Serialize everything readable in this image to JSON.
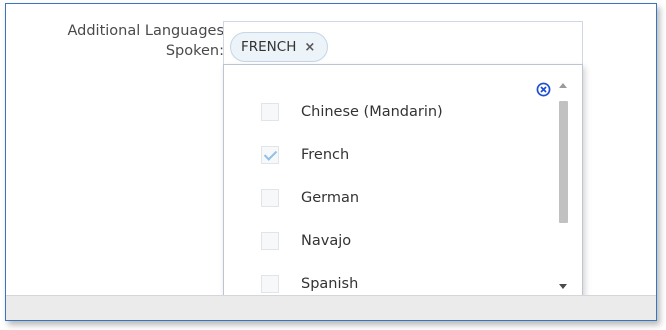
{
  "field": {
    "label_line1": "Additional Languages",
    "label_line2": "Spoken:"
  },
  "selected_chips": [
    {
      "label": "FRENCH",
      "remove_symbol": "×"
    }
  ],
  "dropdown": {
    "clear_icon": "circle-x-icon",
    "options": [
      {
        "label": "Chinese (Mandarin)",
        "checked": false
      },
      {
        "label": "French",
        "checked": true
      },
      {
        "label": "German",
        "checked": false
      },
      {
        "label": "Navajo",
        "checked": false
      },
      {
        "label": "Spanish",
        "checked": false
      }
    ]
  },
  "colors": {
    "frame_border": "#3a76c0",
    "chip_background": "#ecf3f9",
    "checkmark": "#8ec0ea",
    "clear_icon": "#1f4fd1"
  }
}
